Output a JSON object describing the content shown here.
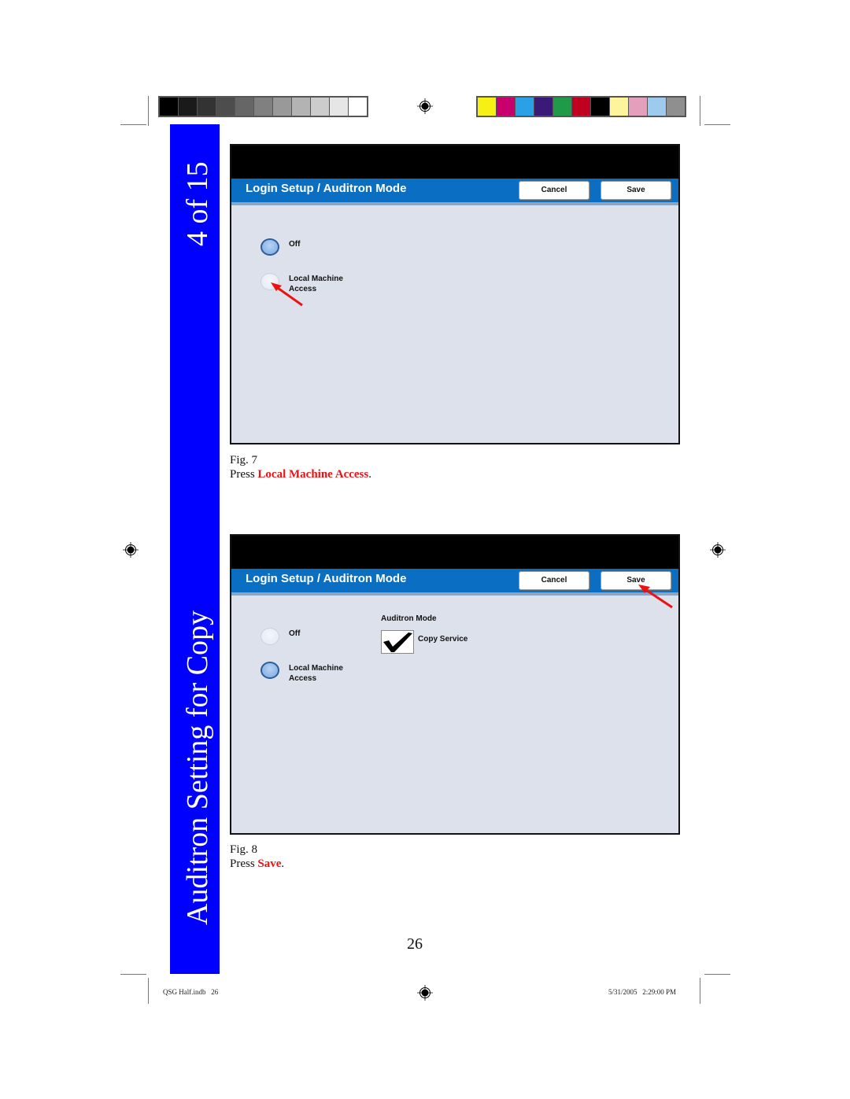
{
  "print_marks": {
    "gray_swatches": [
      "#000000",
      "#1a1a1a",
      "#333333",
      "#4d4d4d",
      "#666666",
      "#808080",
      "#999999",
      "#b3b3b3",
      "#cccccc",
      "#e6e6e6",
      "#ffffff"
    ],
    "color_swatches": [
      "#f7f014",
      "#c8006e",
      "#2aa0e6",
      "#3a1a78",
      "#1f9a48",
      "#c0001e",
      "#000000",
      "#fcf59c",
      "#e49fbc",
      "#9ecaf0",
      "#8f8f8f"
    ]
  },
  "sidebar": {
    "page_counter": "4 of 15",
    "section_title": "Auditron Setting for Copy",
    "color": "#0000ff"
  },
  "figures": [
    {
      "screen": {
        "title": "Login Setup / Auditron Mode",
        "cancel_label": "Cancel",
        "save_label": "Save",
        "options": [
          {
            "label_line1": "Off",
            "label_line2": "",
            "selected": true
          },
          {
            "label_line1": "Local Machine",
            "label_line2": "Access",
            "selected": false
          }
        ]
      },
      "caption_fig": "Fig. 7",
      "caption_prefix": "Press ",
      "caption_highlight": "Local Machine Access",
      "caption_suffix": "."
    },
    {
      "screen": {
        "title": "Login Setup / Auditron Mode",
        "cancel_label": "Cancel",
        "save_label": "Save",
        "options": [
          {
            "label_line1": "Off",
            "label_line2": "",
            "selected": false
          },
          {
            "label_line1": "Local Machine",
            "label_line2": "Access",
            "selected": true
          }
        ],
        "auditron_mode_heading": "Auditron Mode",
        "copy_service_label": "Copy Service",
        "copy_service_checked": true
      },
      "caption_fig": "Fig. 8",
      "caption_prefix": "Press ",
      "caption_highlight": "Save",
      "caption_suffix": "."
    }
  ],
  "page_number": "26",
  "footer": {
    "file": "QSG Half.indb   26",
    "timestamp": "5/31/2005   2:29:00 PM"
  },
  "accent_red": "#ee1111"
}
